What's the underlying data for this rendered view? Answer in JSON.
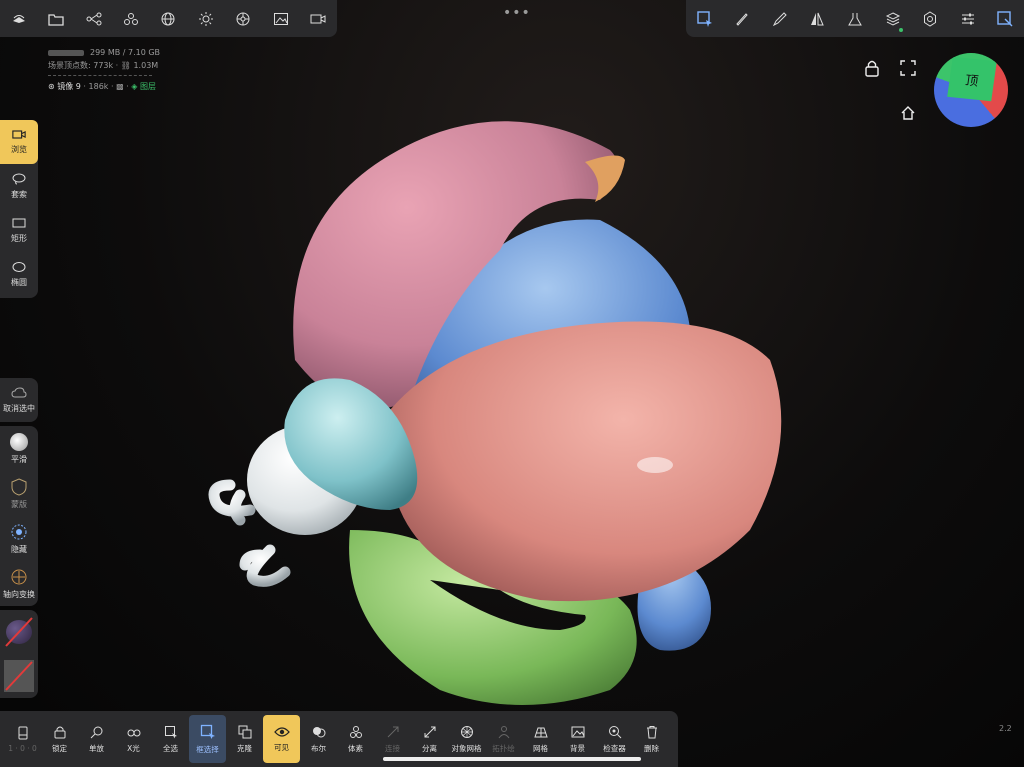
{
  "top_left_tools": [
    "layers",
    "folder",
    "scene-graph",
    "primitives",
    "sphere-mesh",
    "light",
    "material",
    "image",
    "camera"
  ],
  "top_right_tools": [
    "select-tool",
    "brush",
    "pen",
    "mirror",
    "flask",
    "layers",
    "settings",
    "sliders",
    "transform"
  ],
  "stats": {
    "memory": "299 MB / 7.10 GB",
    "scene_vertices": "场景顶点数: 773k · ⛓ 1.03M",
    "selection_name": "镜像 9",
    "selection_count": "186k",
    "selection_layer": "图层"
  },
  "side_tools": [
    {
      "key": "browse",
      "label": "浏览",
      "active": true
    },
    {
      "key": "lasso",
      "label": "套索",
      "active": false
    },
    {
      "key": "rect",
      "label": "矩形",
      "active": false
    },
    {
      "key": "ellipse",
      "label": "椭圆",
      "active": false
    }
  ],
  "deselect": {
    "label": "取消选中"
  },
  "side_tools2": [
    {
      "key": "smooth",
      "label": "平滑"
    },
    {
      "key": "mask",
      "label": "蒙版"
    },
    {
      "key": "hide",
      "label": "隐藏"
    },
    {
      "key": "axis",
      "label": "轴向变换"
    }
  ],
  "view_cube": {
    "top_label": "顶"
  },
  "bottom_tools": [
    {
      "key": "first",
      "label": "1 · 0 · 0",
      "state": "dis"
    },
    {
      "key": "lock",
      "label": "锁定",
      "state": ""
    },
    {
      "key": "solo",
      "label": "单放",
      "state": ""
    },
    {
      "key": "xray",
      "label": "X光",
      "state": ""
    },
    {
      "key": "selall",
      "label": "全选",
      "state": ""
    },
    {
      "key": "box",
      "label": "框选择",
      "state": "sel"
    },
    {
      "key": "clone",
      "label": "克隆",
      "state": ""
    },
    {
      "key": "visible",
      "label": "可见",
      "state": "on"
    },
    {
      "key": "bool",
      "label": "布尔",
      "state": ""
    },
    {
      "key": "voxel",
      "label": "体素",
      "state": ""
    },
    {
      "key": "join",
      "label": "连接",
      "state": "dis"
    },
    {
      "key": "separate",
      "label": "分离",
      "state": ""
    },
    {
      "key": "objmesh",
      "label": "对象网格",
      "state": ""
    },
    {
      "key": "retopo",
      "label": "拓扑绘",
      "state": "dis"
    },
    {
      "key": "grid",
      "label": "网格",
      "state": ""
    },
    {
      "key": "bg",
      "label": "背景",
      "state": ""
    },
    {
      "key": "inspect",
      "label": "检查器",
      "state": ""
    },
    {
      "key": "delete",
      "label": "删除",
      "state": ""
    }
  ],
  "version": "2.2",
  "colors": {
    "accent": "#f0c75a",
    "panel": "#2a2a2c",
    "selected": "#3b4b63",
    "green": "#3cc06a"
  }
}
